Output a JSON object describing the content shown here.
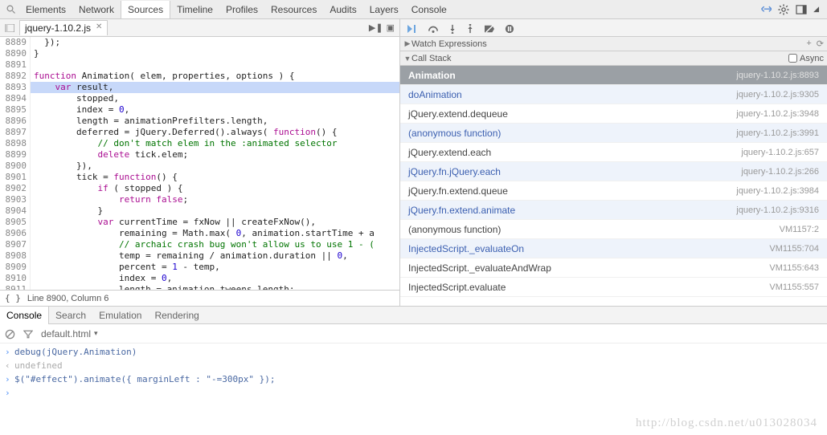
{
  "top_tabs": [
    "Elements",
    "Network",
    "Sources",
    "Timeline",
    "Profiles",
    "Resources",
    "Audits",
    "Layers",
    "Console"
  ],
  "top_tabs_active": "Sources",
  "file_tab": {
    "name": "jquery-1.10.2.js"
  },
  "code": {
    "first_line": 8889,
    "lines": [
      {
        "n": 8889,
        "i": 0,
        "raw": "  });"
      },
      {
        "n": 8890,
        "i": 0,
        "raw": "}"
      },
      {
        "n": 8891,
        "i": 0,
        "raw": ""
      },
      {
        "n": 8892,
        "i": 0,
        "raw": "function Animation( elem, properties, options ) {",
        "kw": "function"
      },
      {
        "n": 8893,
        "i": 1,
        "raw": "    var result,",
        "kw": "var",
        "hl": true
      },
      {
        "n": 8894,
        "i": 2,
        "raw": "        stopped,"
      },
      {
        "n": 8895,
        "i": 2,
        "raw": "        index = 0,",
        "num": "0"
      },
      {
        "n": 8896,
        "i": 2,
        "raw": "        length = animationPrefilters.length,"
      },
      {
        "n": 8897,
        "i": 2,
        "raw": "        deferred = jQuery.Deferred().always( function() {",
        "kw": "function"
      },
      {
        "n": 8898,
        "i": 3,
        "raw": "            // don't match elem in the :animated selector",
        "cmt": true
      },
      {
        "n": 8899,
        "i": 3,
        "raw": "            delete tick.elem;",
        "kw": "delete"
      },
      {
        "n": 8900,
        "i": 2,
        "raw": "        }),"
      },
      {
        "n": 8901,
        "i": 2,
        "raw": "        tick = function() {",
        "kw": "function"
      },
      {
        "n": 8902,
        "i": 3,
        "raw": "            if ( stopped ) {",
        "kw": "if"
      },
      {
        "n": 8903,
        "i": 4,
        "raw": "                return false;",
        "kw": "return",
        "kw2": "false"
      },
      {
        "n": 8904,
        "i": 3,
        "raw": "            }"
      },
      {
        "n": 8905,
        "i": 3,
        "raw": "            var currentTime = fxNow || createFxNow(),",
        "kw": "var"
      },
      {
        "n": 8906,
        "i": 4,
        "raw": "                remaining = Math.max( 0, animation.startTime + a",
        "num": "0"
      },
      {
        "n": 8907,
        "i": 4,
        "raw": "                // archaic crash bug won't allow us to use 1 - (",
        "cmt": true
      },
      {
        "n": 8908,
        "i": 4,
        "raw": "                temp = remaining / animation.duration || 0,",
        "num": "0"
      },
      {
        "n": 8909,
        "i": 4,
        "raw": "                percent = 1 - temp,",
        "num": "1"
      },
      {
        "n": 8910,
        "i": 4,
        "raw": "                index = 0,",
        "num": "0"
      },
      {
        "n": 8911,
        "i": 4,
        "raw": "                length = animation.tweens.length;"
      }
    ]
  },
  "status": {
    "text": "Line 8900, Column 6"
  },
  "debug_panels": {
    "watch": {
      "label": "Watch Expressions"
    },
    "callstack": {
      "label": "Call Stack",
      "async_label": "Async"
    }
  },
  "call_stack": [
    {
      "name": "Animation",
      "loc": "jquery-1.10.2.js:8893",
      "sel": true
    },
    {
      "name": "doAnimation",
      "loc": "jquery-1.10.2.js:9305",
      "alt": true
    },
    {
      "name": "jQuery.extend.dequeue",
      "loc": "jquery-1.10.2.js:3948"
    },
    {
      "name": "(anonymous function)",
      "loc": "jquery-1.10.2.js:3991",
      "alt": true
    },
    {
      "name": "jQuery.extend.each",
      "loc": "jquery-1.10.2.js:657"
    },
    {
      "name": "jQuery.fn.jQuery.each",
      "loc": "jquery-1.10.2.js:266",
      "alt": true
    },
    {
      "name": "jQuery.fn.extend.queue",
      "loc": "jquery-1.10.2.js:3984"
    },
    {
      "name": "jQuery.fn.extend.animate",
      "loc": "jquery-1.10.2.js:9316",
      "alt": true
    },
    {
      "name": "(anonymous function)",
      "loc": "VM1157:2"
    },
    {
      "name": "InjectedScript._evaluateOn",
      "loc": "VM1155:704",
      "alt": true
    },
    {
      "name": "InjectedScript._evaluateAndWrap",
      "loc": "VM1155:643"
    },
    {
      "name": "InjectedScript.evaluate",
      "loc": "VM1155:557"
    }
  ],
  "bottom_tabs": [
    "Console",
    "Search",
    "Emulation",
    "Rendering"
  ],
  "bottom_tabs_active": "Console",
  "console_filter": "default.html",
  "console_lines": [
    {
      "type": "input",
      "text": "debug(jQuery.Animation)"
    },
    {
      "type": "output",
      "text": "undefined"
    },
    {
      "type": "input",
      "text": "$(\"#effect\").animate({ marginLeft : \"-=300px\" });"
    },
    {
      "type": "input",
      "text": ""
    }
  ],
  "watermark": "http://blog.csdn.net/u013028034"
}
